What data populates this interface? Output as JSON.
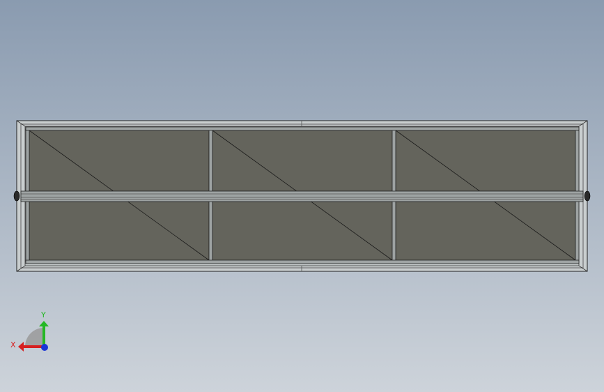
{
  "viewport": {
    "background_top": "#8A9BB0",
    "background_bottom": "#CDD3DA"
  },
  "model": {
    "frame_fill": "#C9CECF",
    "frame_edge": "#222222",
    "panel_fill": "#64645C",
    "bar_fill": "#9EA3A3",
    "panel_columns": 3,
    "panel_rows": 2
  },
  "triad": {
    "x_label": "X",
    "y_label": "Y",
    "x_color": "#D62020",
    "y_color": "#25B825",
    "z_color": "#1A35D6",
    "plane_color": "#9A9A9A"
  }
}
